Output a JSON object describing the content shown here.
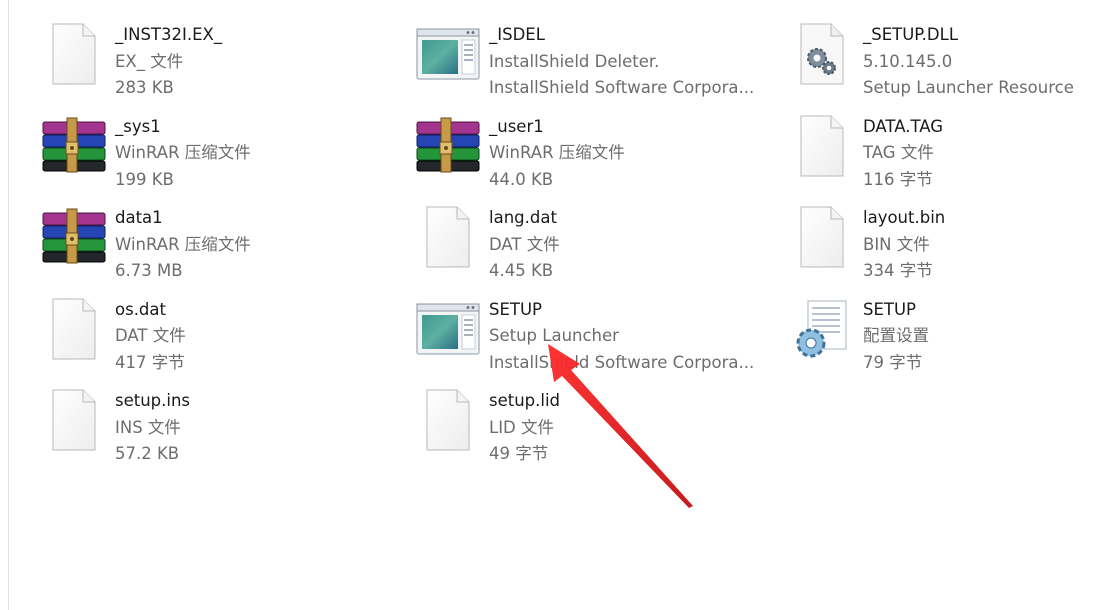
{
  "files": [
    {
      "name": "_INST32I.EX_",
      "line2": "EX_ 文件",
      "line3": "283 KB",
      "icon": "blank-file-icon"
    },
    {
      "name": "_ISDEL",
      "line2": "InstallShield Deleter.",
      "line3": "InstallShield Software Corpora...",
      "icon": "app-window-icon"
    },
    {
      "name": "_SETUP.DLL",
      "line2": "5.10.145.0",
      "line3": "Setup Launcher Resource",
      "icon": "dll-gear-icon"
    },
    {
      "name": "_sys1",
      "line2": "WinRAR 压缩文件",
      "line3": "199 KB",
      "icon": "winrar-archive-icon"
    },
    {
      "name": "_user1",
      "line2": "WinRAR 压缩文件",
      "line3": "44.0 KB",
      "icon": "winrar-archive-icon"
    },
    {
      "name": "DATA.TAG",
      "line2": "TAG 文件",
      "line3": "116 字节",
      "icon": "blank-file-icon"
    },
    {
      "name": "data1",
      "line2": "WinRAR 压缩文件",
      "line3": "6.73 MB",
      "icon": "winrar-archive-icon"
    },
    {
      "name": "lang.dat",
      "line2": "DAT 文件",
      "line3": "4.45 KB",
      "icon": "blank-file-icon"
    },
    {
      "name": "layout.bin",
      "line2": "BIN 文件",
      "line3": "334 字节",
      "icon": "blank-file-icon"
    },
    {
      "name": "os.dat",
      "line2": "DAT 文件",
      "line3": "417 字节",
      "icon": "blank-file-icon"
    },
    {
      "name": "SETUP",
      "line2": "Setup Launcher",
      "line3": "InstallShield Software Corpora...",
      "icon": "app-window-icon"
    },
    {
      "name": "SETUP",
      "line2": "配置设置",
      "line3": "79 字节",
      "icon": "config-settings-icon"
    },
    {
      "name": "setup.ins",
      "line2": "INS 文件",
      "line3": "57.2 KB",
      "icon": "blank-file-icon"
    },
    {
      "name": "setup.lid",
      "line2": "LID 文件",
      "line3": "49 字节",
      "icon": "blank-file-icon"
    }
  ],
  "annotation": {
    "arrow_color": "#e8191d",
    "points_to": "SETUP"
  }
}
